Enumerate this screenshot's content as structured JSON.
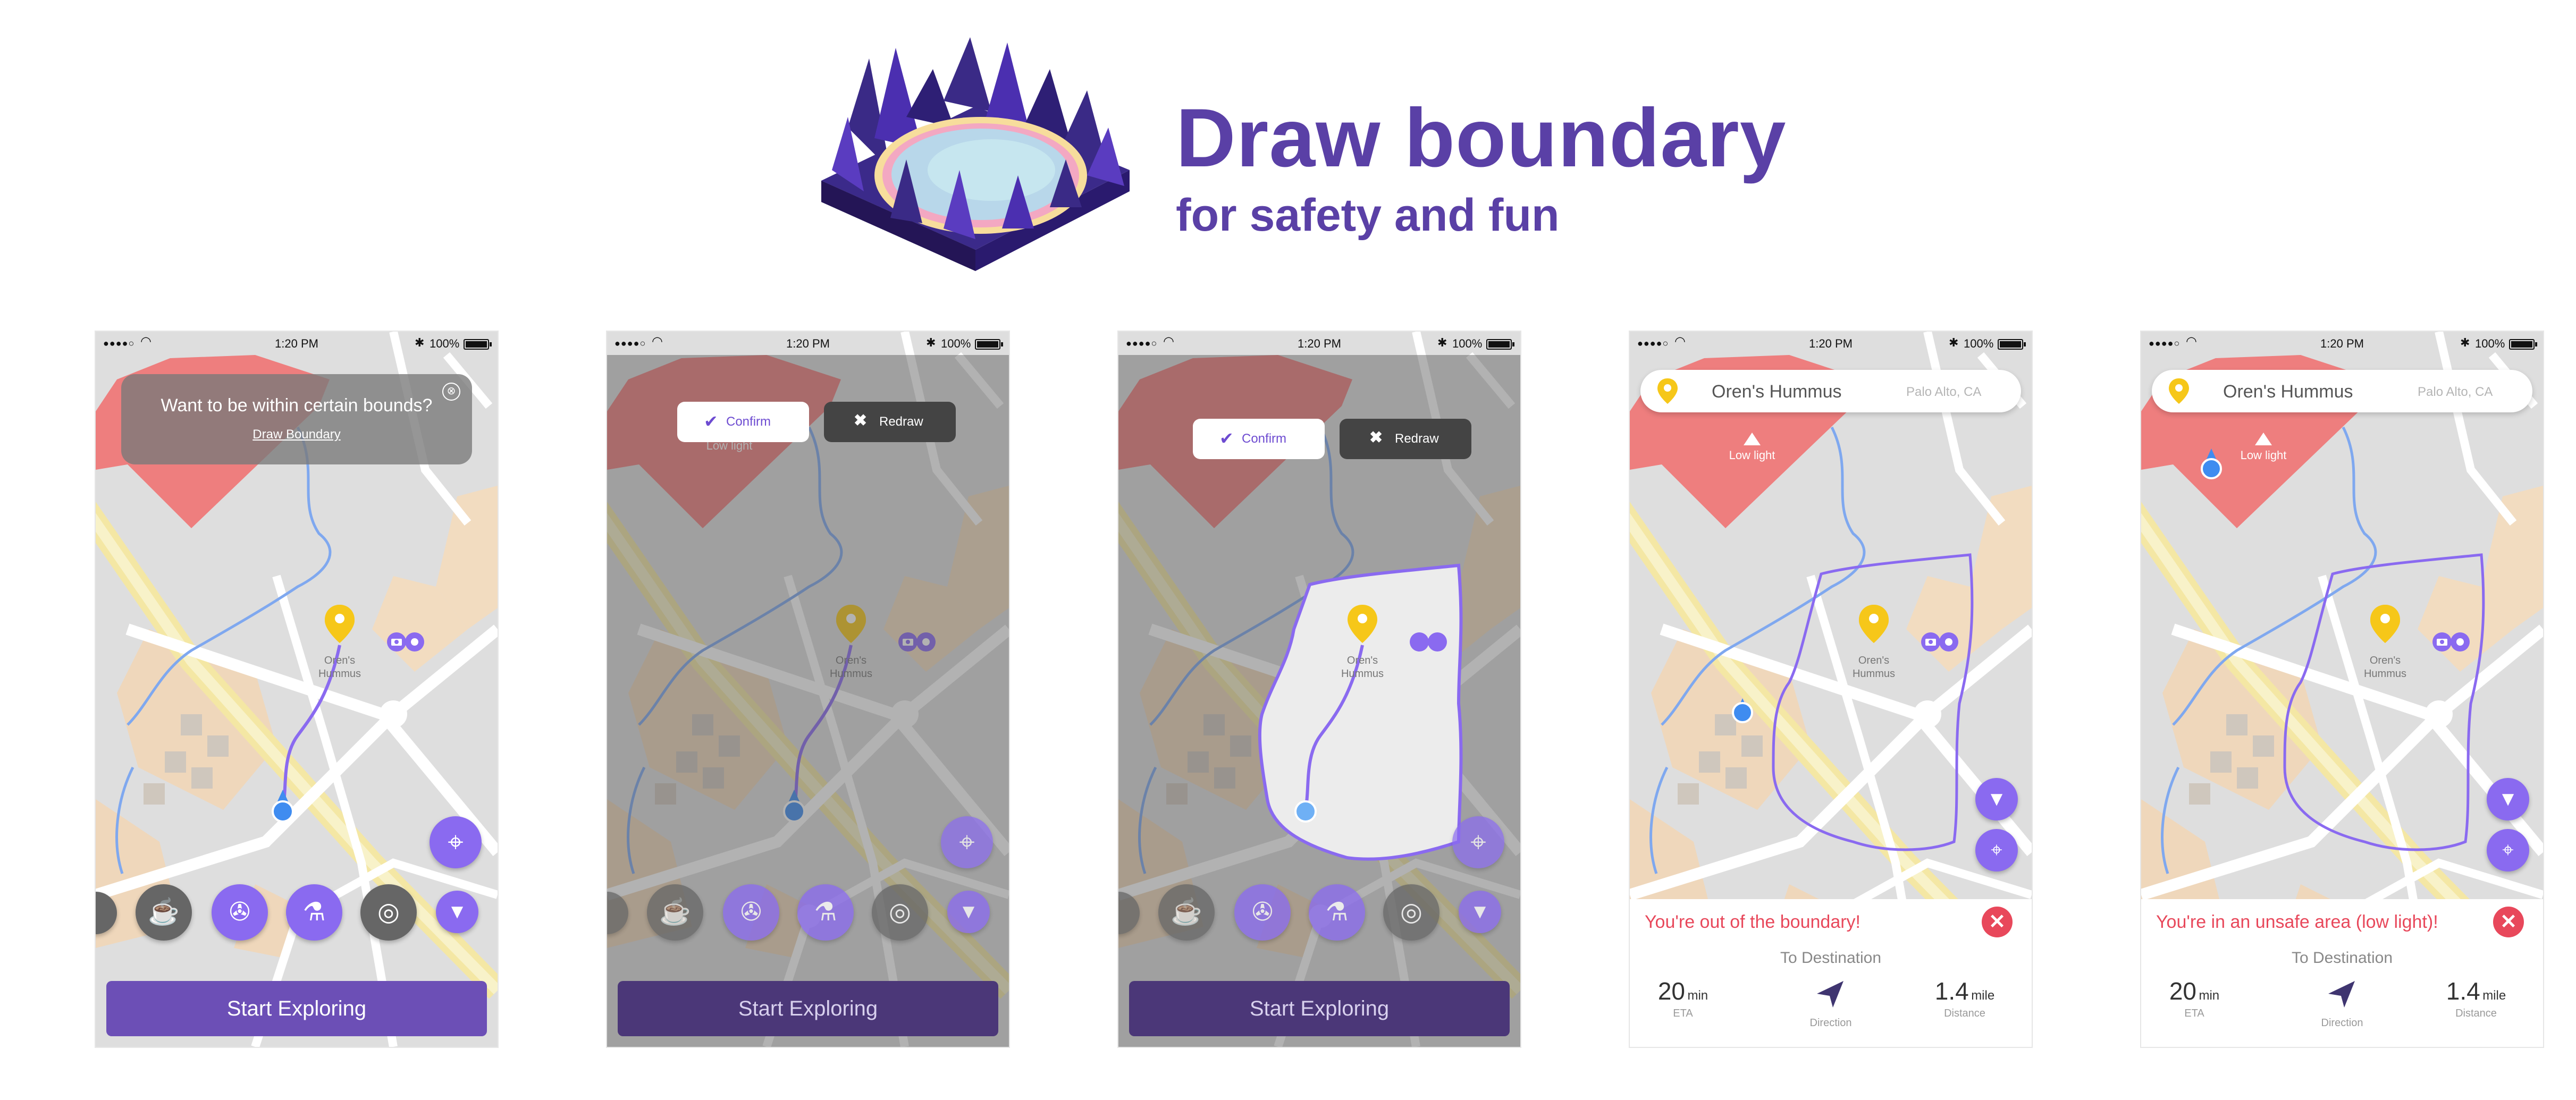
{
  "hero": {
    "title": "Draw boundary",
    "subtitle": "for safety and fun"
  },
  "status_bar": {
    "signal": "●●●●○",
    "time": "1:20 PM",
    "battery": "100%"
  },
  "map": {
    "place_name_line1": "Oren's",
    "place_name_line2": "Hummus",
    "zone_label": "Low light"
  },
  "screen1": {
    "tooltip_question": "Want to be within certain bounds?",
    "tooltip_link": "Draw Boundary",
    "tooltip_close": "⊗",
    "cta": "Start Exploring"
  },
  "screen2": {
    "confirm": "Confirm",
    "redraw": "Redraw",
    "cta": "Start Exploring"
  },
  "screen3": {
    "confirm": "Confirm",
    "redraw": "Redraw",
    "cta": "Start Exploring"
  },
  "screen4": {
    "search_place": "Oren's Hummus",
    "search_location": "Palo Alto, CA",
    "alert": "You're out of the boundary!",
    "to_destination": "To Destination",
    "eta_value": "20",
    "eta_unit": "min",
    "eta_label": "ETA",
    "direction_label": "Direction",
    "distance_value": "1.4",
    "distance_unit": "mile",
    "distance_label": "Distance"
  },
  "screen5": {
    "search_place": "Oren's Hummus",
    "search_location": "Palo Alto, CA",
    "alert": "You're in an unsafe area (low light)!",
    "to_destination": "To Destination",
    "eta_value": "20",
    "eta_unit": "min",
    "eta_label": "ETA",
    "direction_label": "Direction",
    "distance_value": "1.4",
    "distance_unit": "mile",
    "distance_label": "Distance"
  },
  "colors": {
    "brand_purple": "#5a40a6",
    "button_purple": "#6c4fb6",
    "accent_purple": "#8a6af0",
    "alert_red": "#e8485b",
    "unsafe_zone": "#ee7e7e",
    "pin_yellow": "#f6c719",
    "user_blue": "#3f8cf0"
  },
  "icons": {
    "category_1": "coffee-cup-icon",
    "category_2": "film-reel-icon",
    "category_3": "microscope-icon",
    "category_4": "vinyl-record-icon",
    "filter": "filter-icon",
    "locate": "crosshair-icon",
    "camera": "camera-icon",
    "direction": "navigation-arrow-icon"
  }
}
